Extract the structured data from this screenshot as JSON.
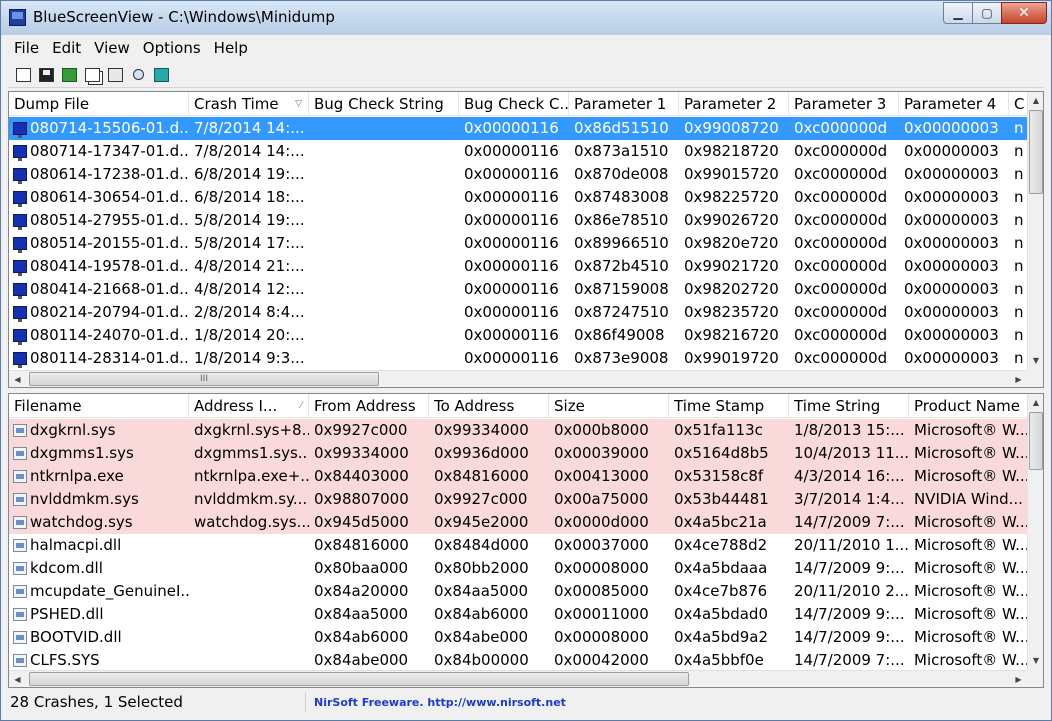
{
  "window": {
    "title": "BlueScreenView  -  C:\\Windows\\Minidump",
    "minimize_label": "▁",
    "maximize_label": "▢",
    "close_label": "✕"
  },
  "menu": {
    "items": [
      "File",
      "Edit",
      "View",
      "Options",
      "Help"
    ]
  },
  "toolbar": {
    "icons": [
      "html-report-icon",
      "save-icon",
      "refresh-icon",
      "copy-icon",
      "properties-icon",
      "find-icon",
      "exit-icon"
    ]
  },
  "crash_list": {
    "columns": [
      "Dump File",
      "Crash Time",
      "Bug Check String",
      "Bug Check C...",
      "Parameter 1",
      "Parameter 2",
      "Parameter 3",
      "Parameter 4",
      "C"
    ],
    "sort_indicator": "▽",
    "rows": [
      [
        "080714-15506-01.d...",
        "7/8/2014 14:...",
        "",
        "0x00000116",
        "0x86d51510",
        "0x99008720",
        "0xc000000d",
        "0x00000003",
        "n"
      ],
      [
        "080714-17347-01.d...",
        "7/8/2014 14:...",
        "",
        "0x00000116",
        "0x873a1510",
        "0x98218720",
        "0xc000000d",
        "0x00000003",
        "n"
      ],
      [
        "080614-17238-01.d...",
        "6/8/2014 19:...",
        "",
        "0x00000116",
        "0x870de008",
        "0x99015720",
        "0xc000000d",
        "0x00000003",
        "n"
      ],
      [
        "080614-30654-01.d...",
        "6/8/2014 18:...",
        "",
        "0x00000116",
        "0x87483008",
        "0x98225720",
        "0xc000000d",
        "0x00000003",
        "n"
      ],
      [
        "080514-27955-01.d...",
        "5/8/2014 19:...",
        "",
        "0x00000116",
        "0x86e78510",
        "0x99026720",
        "0xc000000d",
        "0x00000003",
        "n"
      ],
      [
        "080514-20155-01.d...",
        "5/8/2014 17:...",
        "",
        "0x00000116",
        "0x89966510",
        "0x9820e720",
        "0xc000000d",
        "0x00000003",
        "n"
      ],
      [
        "080414-19578-01.d...",
        "4/8/2014 21:...",
        "",
        "0x00000116",
        "0x872b4510",
        "0x99021720",
        "0xc000000d",
        "0x00000003",
        "n"
      ],
      [
        "080414-21668-01.d...",
        "4/8/2014 12:...",
        "",
        "0x00000116",
        "0x87159008",
        "0x98202720",
        "0xc000000d",
        "0x00000003",
        "n"
      ],
      [
        "080214-20794-01.d...",
        "2/8/2014 8:4...",
        "",
        "0x00000116",
        "0x87247510",
        "0x98235720",
        "0xc000000d",
        "0x00000003",
        "n"
      ],
      [
        "080114-24070-01.d...",
        "1/8/2014 20:...",
        "",
        "0x00000116",
        "0x86f49008",
        "0x98216720",
        "0xc000000d",
        "0x00000003",
        "n"
      ],
      [
        "080114-28314-01.d...",
        "1/8/2014 9:3...",
        "",
        "0x00000116",
        "0x873e9008",
        "0x99019720",
        "0xc000000d",
        "0x00000003",
        "n"
      ]
    ]
  },
  "driver_list": {
    "columns": [
      "Filename",
      "Address I...",
      "From Address",
      "To Address",
      "Size",
      "Time Stamp",
      "Time String",
      "Product Name"
    ],
    "sort_indicator": "⁄",
    "rows": [
      [
        "dxgkrnl.sys",
        "dxgkrnl.sys+8...",
        "0x9927c000",
        "0x99334000",
        "0x000b8000",
        "0x51fa113c",
        "1/8/2013 15:...",
        "Microsoft® W..."
      ],
      [
        "dxgmms1.sys",
        "dxgmms1.sys...",
        "0x99334000",
        "0x9936d000",
        "0x00039000",
        "0x5164d8b5",
        "10/4/2013 11...",
        "Microsoft® W..."
      ],
      [
        "ntkrnlpa.exe",
        "ntkrnlpa.exe+...",
        "0x84403000",
        "0x84816000",
        "0x00413000",
        "0x53158c8f",
        "4/3/2014 16:...",
        "Microsoft® W..."
      ],
      [
        "nvlddmkm.sys",
        "nvlddmkm.sy...",
        "0x98807000",
        "0x9927c000",
        "0x00a75000",
        "0x53b44481",
        "3/7/2014 1:4...",
        "NVIDIA Wind..."
      ],
      [
        "watchdog.sys",
        "watchdog.sys...",
        "0x945d5000",
        "0x945e2000",
        "0x0000d000",
        "0x4a5bc21a",
        "14/7/2009 7:...",
        "Microsoft® W..."
      ],
      [
        "halmacpi.dll",
        "",
        "0x84816000",
        "0x8484d000",
        "0x00037000",
        "0x4ce788d2",
        "20/11/2010 1...",
        "Microsoft® W..."
      ],
      [
        "kdcom.dll",
        "",
        "0x80baa000",
        "0x80bb2000",
        "0x00008000",
        "0x4a5bdaaa",
        "14/7/2009 9:...",
        "Microsoft® W..."
      ],
      [
        "mcupdate_GenuineI...",
        "",
        "0x84a20000",
        "0x84aa5000",
        "0x00085000",
        "0x4ce7b876",
        "20/11/2010 2...",
        "Microsoft® W..."
      ],
      [
        "PSHED.dll",
        "",
        "0x84aa5000",
        "0x84ab6000",
        "0x00011000",
        "0x4a5bdad0",
        "14/7/2009 9:...",
        "Microsoft® W..."
      ],
      [
        "BOOTVID.dll",
        "",
        "0x84ab6000",
        "0x84abe000",
        "0x00008000",
        "0x4a5bd9a2",
        "14/7/2009 9:...",
        "Microsoft® W..."
      ],
      [
        "CLFS.SYS",
        "",
        "0x84abe000",
        "0x84b00000",
        "0x00042000",
        "0x4a5bbf0e",
        "14/7/2009 7:...",
        "Microsoft® W..."
      ]
    ],
    "highlighted_count": 5
  },
  "scrollbar": {
    "up": "▲",
    "down": "▼",
    "left": "◀",
    "right": "▶",
    "grip": "III"
  },
  "status": {
    "summary": "28 Crashes, 1 Selected",
    "link": "NirSoft Freeware.  http://www.nirsoft.net"
  },
  "colors": {
    "selection": "#3399ff",
    "highlight_row": "#f9d9d9",
    "link": "#1a3ccc"
  }
}
